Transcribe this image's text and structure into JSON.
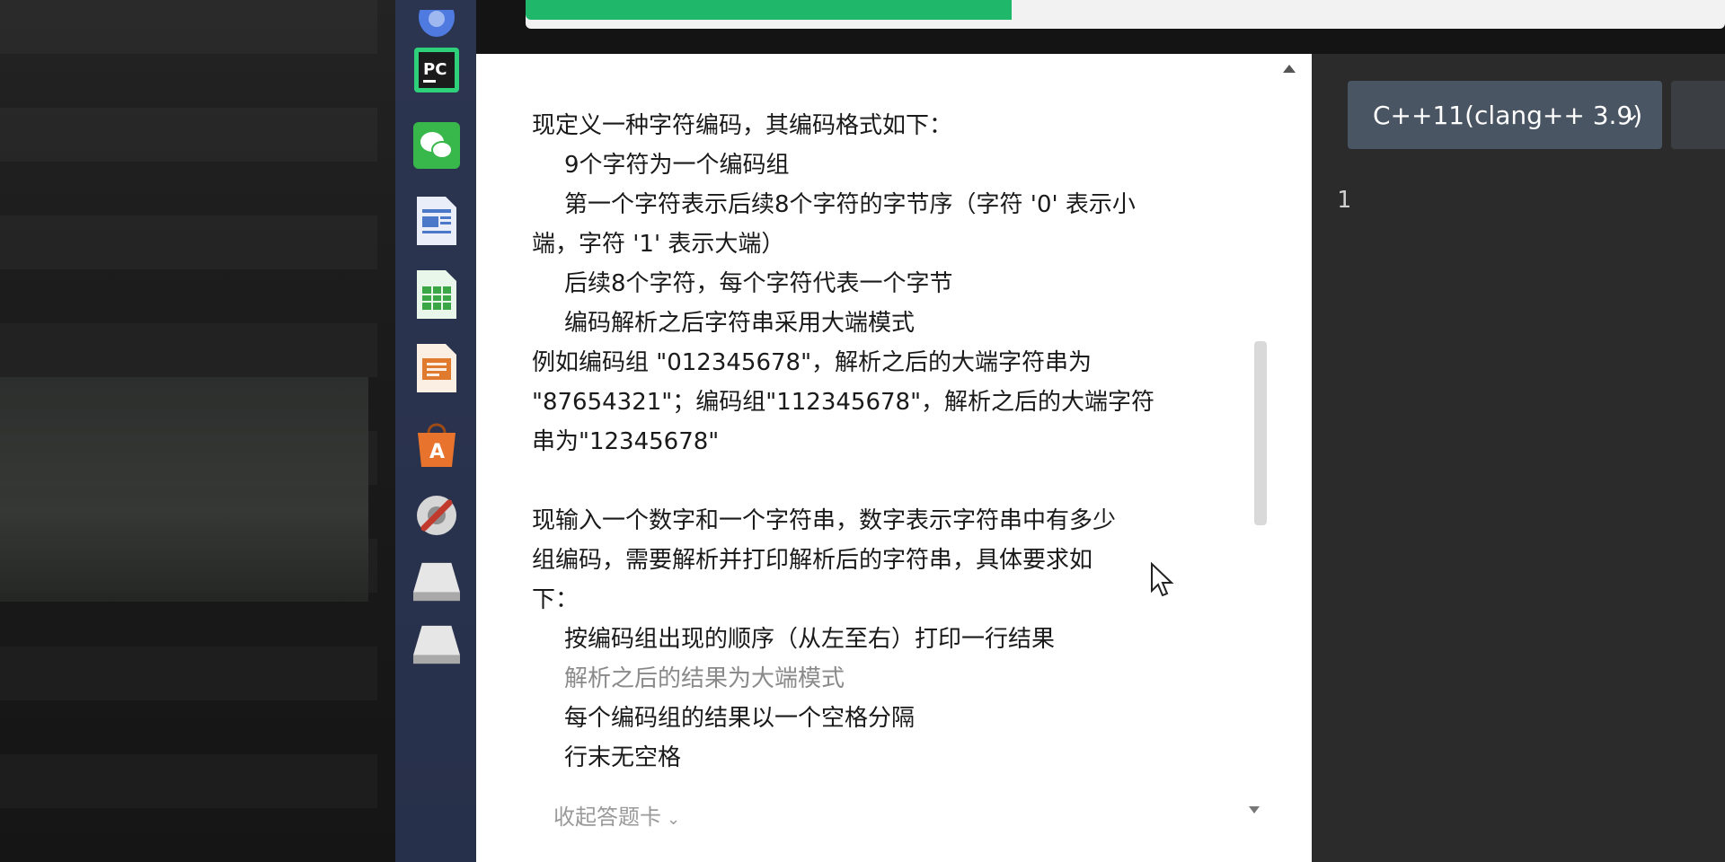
{
  "dock": {
    "items": [
      {
        "name": "browser-icon",
        "color": "#4f7be0"
      },
      {
        "name": "pycharm-icon",
        "color": "#1f1f1f",
        "label": "PC"
      },
      {
        "name": "wechat-icon",
        "color": "#38b84a"
      },
      {
        "name": "writer-icon",
        "color": "#4b78c9"
      },
      {
        "name": "calc-icon",
        "color": "#3aa645"
      },
      {
        "name": "impress-icon",
        "color": "#e07a2f"
      },
      {
        "name": "software-center-icon",
        "color": "#e7732d"
      },
      {
        "name": "settings-icon",
        "color": "#c23a2d"
      },
      {
        "name": "drive-icon",
        "color": "#cfcfcf"
      },
      {
        "name": "drive-icon-2",
        "color": "#cfcfcf"
      }
    ]
  },
  "progress": {
    "value_fraction": 0.405,
    "color": "#1fb86b"
  },
  "question": {
    "lines": [
      {
        "text": "现定义一种字符编码，其编码格式如下：",
        "style": "normal"
      },
      {
        "text": "9个字符为一个编码组",
        "style": "indent"
      },
      {
        "text": "第一个字符表示后续8个字符的字节序（字符 '0' 表示小",
        "style": "indent"
      },
      {
        "text": "端，字符 '1' 表示大端）",
        "style": "normal"
      },
      {
        "text": "后续8个字符，每个字符代表一个字节",
        "style": "indent"
      },
      {
        "text": "编码解析之后字符串采用大端模式",
        "style": "indent"
      },
      {
        "text": "例如编码组 \"012345678\"，解析之后的大端字符串为",
        "style": "normal"
      },
      {
        "text": "\"87654321\"；编码组\"112345678\"，解析之后的大端字符",
        "style": "normal"
      },
      {
        "text": "串为\"12345678\"",
        "style": "normal"
      },
      {
        "text": "",
        "style": "gap"
      },
      {
        "text": "现输入一个数字和一个字符串，数字表示字符串中有多少",
        "style": "normal"
      },
      {
        "text": "组编码，需要解析并打印解析后的字符串，具体要求如",
        "style": "normal"
      },
      {
        "text": "下：",
        "style": "normal"
      },
      {
        "text": "按编码组出现的顺序（从左至右）打印一行结果",
        "style": "indent"
      },
      {
        "text": "解析之后的结果为大端模式",
        "style": "indent-dim"
      },
      {
        "text": "每个编码组的结果以一个空格分隔",
        "style": "indent"
      },
      {
        "text": "行末无空格",
        "style": "indent"
      }
    ],
    "collapse_label": "收起答题卡",
    "collapse_chevron": "⌄"
  },
  "editor": {
    "language": "C++11(clang++ 3.9)",
    "language_chevron": "⌄",
    "line_numbers": [
      "1"
    ]
  }
}
